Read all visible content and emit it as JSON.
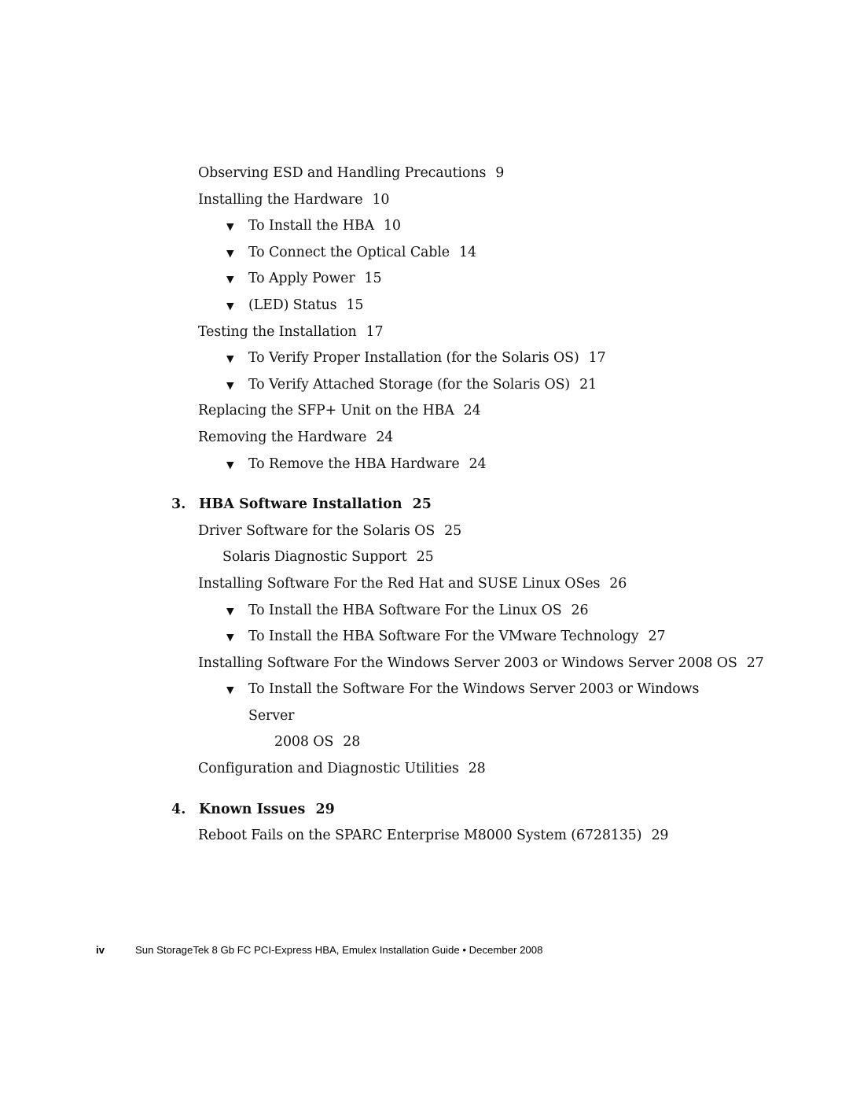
{
  "document": {
    "page_label": "iv",
    "footer_text": "Sun StorageTek 8 Gb FC PCI-Express HBA, Emulex Installation Guide • December 2008"
  },
  "icons": {
    "procedure_marker": "▼"
  },
  "toc": {
    "entries": [
      {
        "level": "1",
        "title": "Observing ESD and Handling Precautions",
        "page": "9"
      },
      {
        "level": "1",
        "title": "Installing the Hardware",
        "page": "10"
      },
      {
        "level": "proc",
        "title": "To Install the HBA",
        "page": "10"
      },
      {
        "level": "proc",
        "title": "To Connect the Optical Cable",
        "page": "14"
      },
      {
        "level": "proc",
        "title": "To Apply Power",
        "page": "15"
      },
      {
        "level": "proc",
        "title": "(LED) Status",
        "page": "15"
      },
      {
        "level": "1",
        "title": "Testing the Installation",
        "page": "17"
      },
      {
        "level": "proc",
        "title": "To Verify Proper Installation (for the Solaris OS)",
        "page": "17"
      },
      {
        "level": "proc",
        "title": "To Verify Attached Storage (for the Solaris OS)",
        "page": "21"
      },
      {
        "level": "1",
        "title": "Replacing the SFP+ Unit on the HBA",
        "page": "24"
      },
      {
        "level": "1",
        "title": "Removing the Hardware",
        "page": "24"
      },
      {
        "level": "proc",
        "title": "To Remove the HBA Hardware",
        "page": "24"
      },
      {
        "level": "chapter",
        "number": "3.",
        "title": "HBA Software Installation",
        "page": "25"
      },
      {
        "level": "1",
        "title": "Driver Software for the Solaris OS",
        "page": "25"
      },
      {
        "level": "2",
        "title": "Solaris Diagnostic Support",
        "page": "25"
      },
      {
        "level": "1",
        "title": "Installing Software For the Red Hat and SUSE Linux OSes",
        "page": "26"
      },
      {
        "level": "proc",
        "title": "To Install the HBA Software For the Linux OS",
        "page": "26"
      },
      {
        "level": "proc",
        "title": "To Install the HBA Software For the VMware Technology",
        "page": "27"
      },
      {
        "level": "1",
        "title": "Installing Software For the Windows Server 2003 or Windows Server 2008 OS",
        "page": "27"
      },
      {
        "level": "proc-wrap",
        "title": "To Install the Software For the Windows Server 2003 or Windows Server",
        "continuation": "2008 OS",
        "page": "28"
      },
      {
        "level": "1",
        "title": "Configuration and Diagnostic Utilities",
        "page": "28"
      },
      {
        "level": "chapter",
        "number": "4.",
        "title": "Known Issues",
        "page": "29"
      },
      {
        "level": "1",
        "title": "Reboot Fails on the SPARC Enterprise M8000 System (6728135)",
        "page": "29"
      }
    ]
  }
}
